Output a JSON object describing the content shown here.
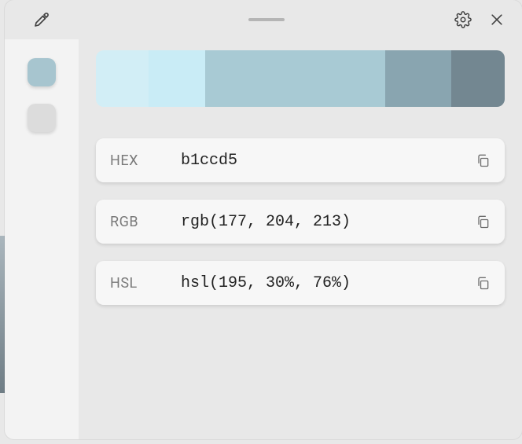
{
  "titlebar": {
    "eyedropper_icon": "eyedropper",
    "settings_icon": "gear",
    "close_icon": "close"
  },
  "sidebar": {
    "swatches": [
      {
        "color": "#a7c5cf",
        "active": true
      },
      {
        "color": "#dcdcdc",
        "active": false
      }
    ]
  },
  "palette": [
    {
      "color": "#d2eef6",
      "width": 12.9
    },
    {
      "color": "#c9ecf6",
      "width": 13.8
    },
    {
      "color": "#a8cad4",
      "width": 44.0
    },
    {
      "color": "#89a5b0",
      "width": 16.2
    },
    {
      "color": "#738791",
      "width": 13.1
    }
  ],
  "values": [
    {
      "label": "HEX",
      "value": "b1ccd5"
    },
    {
      "label": "RGB",
      "value": "rgb(177, 204, 213)"
    },
    {
      "label": "HSL",
      "value": "hsl(195, 30%, 76%)"
    }
  ]
}
